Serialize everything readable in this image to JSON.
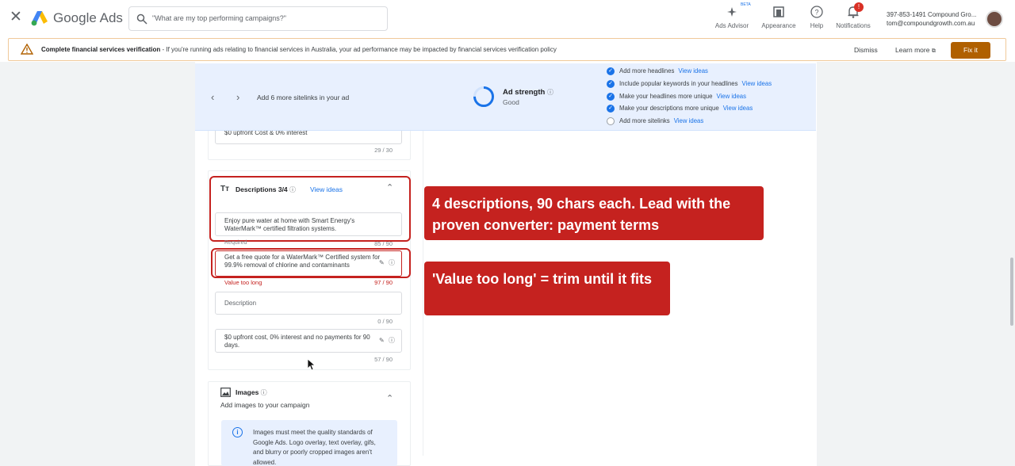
{
  "topbar": {
    "brand": "Google Ads",
    "search_placeholder": "\"What are my top performing campaigns?\"",
    "tools": [
      {
        "label": "Ads Advisor",
        "icon": "sparkle-icon"
      },
      {
        "label": "Appearance",
        "icon": "appearance-icon"
      },
      {
        "label": "Help",
        "icon": "help-icon"
      },
      {
        "label": "Notifications",
        "icon": "bell-icon"
      }
    ],
    "beta": "BETA",
    "notification_count": "!",
    "account_line1": "397-853-1491 Compound Gro...",
    "account_line2": "tom@compoundgrowth.com.au"
  },
  "banner": {
    "title": "Complete financial services verification",
    "message": " - If you're running ads relating to financial services in Australia, your ad performance may be impacted by financial services verification policy",
    "dismiss": "Dismiss",
    "learn_more": "Learn more",
    "fix_it": "Fix it"
  },
  "strength_bar": {
    "hint": "Add 6 more sitelinks in your ad",
    "label": "Ad strength",
    "value": "Good",
    "checklist": [
      {
        "text": "Add more headlines",
        "link": "View ideas",
        "done": true
      },
      {
        "text": "Include popular keywords in your headlines",
        "link": "View ideas",
        "done": true
      },
      {
        "text": "Make your headlines more unique",
        "link": "View ideas",
        "done": true
      },
      {
        "text": "Make your descriptions more unique",
        "link": "View ideas",
        "done": true
      },
      {
        "text": "Add more sitelinks",
        "link": "View ideas",
        "done": false
      }
    ]
  },
  "headline_tail": {
    "value": "$0 upfront Cost & 0% interest",
    "count": "29 / 30"
  },
  "descriptions": {
    "title": "Descriptions 3/4",
    "view_ideas": "View ideas",
    "fields": [
      {
        "value": "Enjoy pure water at home with Smart Energy's WaterMark™ certified filtration systems.",
        "sub": "Required",
        "count": "85 / 90"
      },
      {
        "value": "Get a free quote for a WaterMark™ Certified system for 99.9% removal of chlorine and contaminants",
        "error": "Value too long",
        "count": "97 / 90"
      },
      {
        "placeholder": "Description",
        "count": "0 / 90"
      },
      {
        "value": "$0 upfront cost, 0% interest and no payments for 90 days.",
        "count": "57 / 90"
      }
    ]
  },
  "images": {
    "title": "Images",
    "subtitle": "Add images to your campaign",
    "info": "Images must meet the quality standards of Google Ads. Logo overlay, text overlay, gifs, and blurry or poorly cropped images aren't allowed."
  },
  "callouts": [
    "4 descriptions, 90 chars each. Lead with the proven converter: payment terms",
    "'Value too long' = trim until it fits"
  ],
  "colors": {
    "accent": "#1a73e8",
    "error": "#c5221f",
    "warning": "#b06000",
    "strength_bg": "#e8f0fe"
  }
}
